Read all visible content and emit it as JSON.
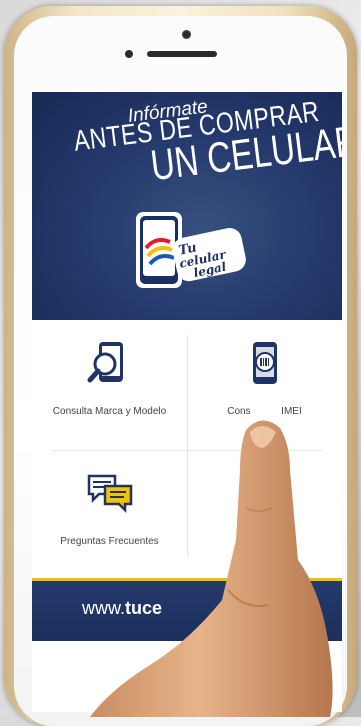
{
  "banner": {
    "line1": "Infórmate",
    "line2": "ANTES DE COMPRAR",
    "line3": "UN CELULAR",
    "logo_text": "Tu celular legal"
  },
  "tiles": [
    {
      "label": "Consulta Marca y Modelo",
      "icon": "magnifier-phone-icon"
    },
    {
      "label": "Consulta IMEI",
      "label_visible": "Cons           IMEI",
      "icon": "barcode-phone-icon"
    },
    {
      "label": "Preguntas Frecuentes",
      "icon": "chat-bubbles-icon"
    }
  ],
  "footer": {
    "url_prefix": "www.",
    "url_bold": "tuce"
  },
  "colors": {
    "navy": "#1f3366",
    "accent_yellow": "#f1c400",
    "frame_gold": "#e9d6ad"
  }
}
